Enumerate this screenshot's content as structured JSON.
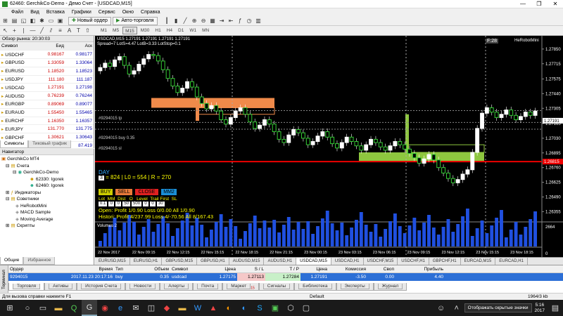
{
  "title": "62460: GerchikCo-Demo - Демо Счет - [USDCAD,M15]",
  "menu": [
    "Файл",
    "Вид",
    "Вставка",
    "Графики",
    "Сервис",
    "Окно",
    "Справка"
  ],
  "toolbar": {
    "new_order": "Новый ордер",
    "autotrading": "Авто-торговля"
  },
  "timeframes": [
    "M1",
    "M5",
    "M15",
    "M30",
    "H1",
    "H4",
    "D1",
    "W1",
    "MN"
  ],
  "timeframe_selected": "M15",
  "market_watch": {
    "header": "Обзор рынка: 20:30:03",
    "col_symbol": "Символ",
    "col_bid": "Бид",
    "col_ask": "Аск",
    "rows": [
      [
        "USDCHF",
        "0.98167",
        "0.98177"
      ],
      [
        "GBPUSD",
        "1.33059",
        "1.33064"
      ],
      [
        "EURUSD",
        "1.18520",
        "1.18523"
      ],
      [
        "USDJPY",
        "111.180",
        "111.187"
      ],
      [
        "USDCAD",
        "1.27191",
        "1.27198"
      ],
      [
        "AUDUSD",
        "0.76239",
        "0.76244"
      ],
      [
        "EURGBP",
        "0.89069",
        "0.89077"
      ],
      [
        "EURAUD",
        "1.55450",
        "1.55465"
      ],
      [
        "EURCHF",
        "1.16350",
        "1.16357"
      ],
      [
        "EURJPY",
        "131.770",
        "131.775"
      ],
      [
        "GBPCHF",
        "1.30621",
        "1.30643"
      ],
      [
        "CADJPY",
        "87.409",
        "87.419"
      ]
    ],
    "tabs": [
      "Символы",
      "Тиковый график"
    ]
  },
  "navigator": {
    "header": "Навигатор",
    "items": [
      "GerchikCo MT4",
      "Счета",
      "GerchikCo-Demo",
      "62330: Igorek",
      "62460: Igorek",
      "Индикаторы",
      "Советники",
      "HeRobotMini",
      "MACD Sample",
      "Moving Average",
      "Скрипты"
    ],
    "tabs": [
      "Общие",
      "Избранное"
    ]
  },
  "chart": {
    "info_line1": "USDCAD,M15 1.27191 1.27191 1.27191 1.27191",
    "info_line2": "Spread=7 LotS=4.47 LotB=3.33 LotStop=0.1",
    "ea_name": "HeRobotMini",
    "timer": "F:28",
    "day_label": "DAY",
    "stats": "= 824 | L0 = 554 | R = 270",
    "stats_num": "3",
    "buttons": [
      "BUY",
      "SELL",
      "CLOSE",
      "MM2"
    ],
    "param_labels": "Lot  MM  Dist   O   Level  Trail First  SL",
    "param_values": [
      "0.1",
      "0",
      "0",
      "50",
      "500",
      "0",
      "0",
      "30"
    ],
    "open_line": "Open:  Profit 1/0.90  Loss 0/0.00  All 1/0.90",
    "hist_line": "Histori: Profit 4/237.99  Loss 4/-70.56  All 8/167.43",
    "order_tp": "#9294015 tp",
    "order_buy": "#9294015 buy 0.35",
    "order_sl": "#9294015 sl",
    "volumes_label": "Volumes 2",
    "vol_max": "2664",
    "vol_zero": "0",
    "price_labels": [
      "1.27850",
      "1.27715",
      "1.27575",
      "1.27440",
      "1.27305",
      "1.27165",
      "1.27030",
      "1.26895",
      "1.26760",
      "1.26625",
      "1.26490",
      "1.26355"
    ],
    "current_price": "1.27191",
    "line_price": "1.26815",
    "time_labels": [
      "22 Nov 2017",
      "22 Nov 09:15",
      "22 Nov 12:15",
      "22 Nov 15:15",
      "22 Nov 18:15",
      "22 Nov 21:15",
      "23 Nov 00:15",
      "23 Nov 03:15",
      "23 Nov 06:15",
      "23 Nov 09:15",
      "23 Nov 12:15",
      "23 Nov 15:15",
      "23 Nov 18:15"
    ]
  },
  "chart_tabs": [
    "EURUSD,M15",
    "EURUSD,H1",
    "GBPUSD,M15",
    "GBPUSD,H1",
    "AUDUSD,M15",
    "AUDUSD,H1",
    "USDCAD,M15",
    "USDCAD,H1",
    "USDCHF,M15",
    "USDCHF,H1",
    "GBPCHF,H1",
    "EURCAD,M15",
    "EURCAD,H1"
  ],
  "chart_tab_active": "USDCAD,M15",
  "terminal": {
    "headers": [
      "Ордер",
      "Время",
      "Тип",
      "Объем",
      "Символ",
      "Цена",
      "S / L",
      "T / P",
      "Цена",
      "Комиссия",
      "Своп",
      "Прибыль"
    ],
    "order": [
      "9294015",
      "2017.11.23 20:17:16",
      "buy",
      "0.35",
      "usdcad",
      "1.27175",
      "1.27113",
      "1.27284",
      "1.27191",
      "-3.50",
      "0.00",
      "4.40"
    ],
    "tabs": [
      "Торговля",
      "Активы",
      "История Счета",
      "Новости",
      "Алерты",
      "Почта",
      "Маркет",
      "Сигналы",
      "Библиотека",
      "Эксперты",
      "Журнал"
    ],
    "market_badge": "15",
    "side_label": "Терминал"
  },
  "status": {
    "help": "Для вызова справки нажмите F1",
    "profile": "Default",
    "traffic": "1964/3 kb"
  },
  "taskbar": {
    "tooltip": "Отображать скрытые значки",
    "time": "5:16",
    "date": "2017"
  }
}
